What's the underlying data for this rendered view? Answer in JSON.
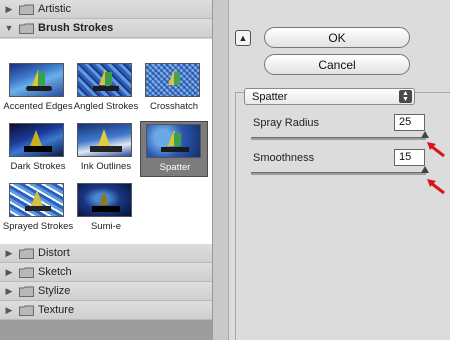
{
  "filter_list": {
    "categories_top": [
      {
        "label": "Artistic",
        "expanded": false
      },
      {
        "label": "Brush Strokes",
        "expanded": true
      }
    ],
    "thumbnails": [
      {
        "label": "Accented Edges",
        "selected": false
      },
      {
        "label": "Angled Strokes",
        "selected": false
      },
      {
        "label": "Crosshatch",
        "selected": false
      },
      {
        "label": "Dark Strokes",
        "selected": false
      },
      {
        "label": "Ink Outlines",
        "selected": false
      },
      {
        "label": "Spatter",
        "selected": true
      },
      {
        "label": "Sprayed Strokes",
        "selected": false
      },
      {
        "label": "Sumi-e",
        "selected": false
      }
    ],
    "categories_bottom": [
      {
        "label": "Distort",
        "expanded": false
      },
      {
        "label": "Sketch",
        "expanded": false
      },
      {
        "label": "Stylize",
        "expanded": false
      },
      {
        "label": "Texture",
        "expanded": false
      }
    ]
  },
  "dialog": {
    "ok_label": "OK",
    "cancel_label": "Cancel",
    "filter_select": "Spatter",
    "params": [
      {
        "label": "Spray Radius",
        "value": "25",
        "slider_fraction": 1.0
      },
      {
        "label": "Smoothness",
        "value": "15",
        "slider_fraction": 1.0
      }
    ]
  },
  "colors": {
    "annotation_arrow": "#d8141c",
    "selected_thumb_bg": "#7c7c7c"
  }
}
